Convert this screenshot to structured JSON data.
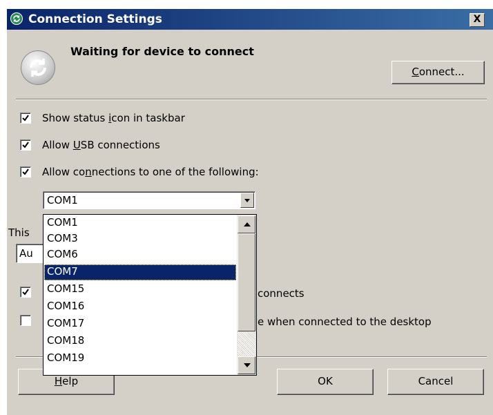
{
  "window": {
    "title": "Connection Settings",
    "close_glyph": "X"
  },
  "status": {
    "text": "Waiting for device to connect"
  },
  "buttons": {
    "connect": {
      "label": "Connect...",
      "mnemonic": "C",
      "rest": "onnect..."
    },
    "help": {
      "label": "Help",
      "mnemonic": "H",
      "rest": "elp"
    },
    "ok": {
      "label": "OK"
    },
    "cancel": {
      "label": "Cancel"
    }
  },
  "options": {
    "show_status_icon": {
      "pre": "Show status ",
      "mnemonic": "i",
      "post": "con in taskbar",
      "checked": true
    },
    "allow_usb": {
      "pre": "Allow ",
      "mnemonic": "U",
      "post": "SB connections",
      "checked": true
    },
    "allow_ports": {
      "pre": "Allow co",
      "mnemonic": "n",
      "post": "nections to one of the following:",
      "checked": true
    },
    "partial_connects": {
      "visible_text": "connects",
      "checked": true
    },
    "partial_desktop": {
      "visible_text": "e when connected to the desktop",
      "checked": false
    }
  },
  "port_select": {
    "value": "COM1",
    "options": [
      "COM1",
      "COM3",
      "COM6",
      "COM7",
      "COM15",
      "COM16",
      "COM17",
      "COM18",
      "COM19"
    ],
    "highlighted": "COM7"
  },
  "partial_label": "This",
  "partial_combo_value": "Au"
}
